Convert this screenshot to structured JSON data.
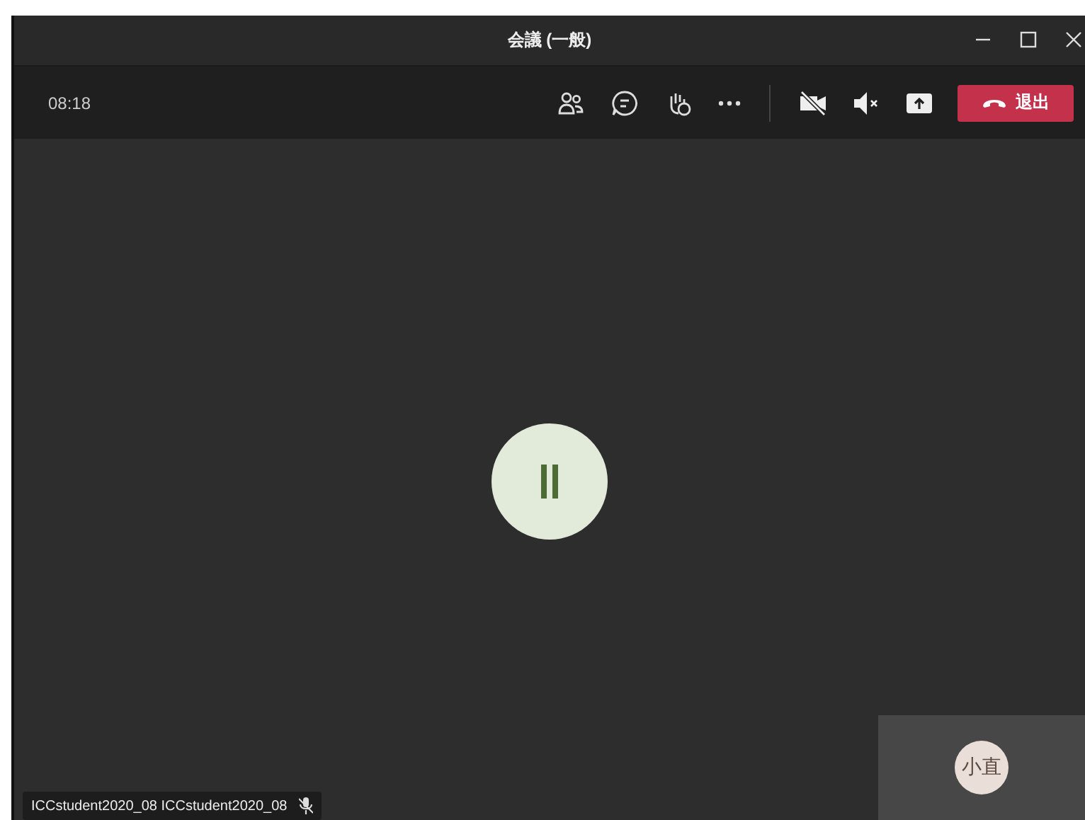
{
  "window": {
    "title": "会議 (一般)"
  },
  "toolbar": {
    "timer": "08:18",
    "leave_button": "退出"
  },
  "participants": [
    {
      "name": "ICCstudent2020_08 ICCstudent2020_08",
      "muted": true
    }
  ],
  "self_view": {
    "initials": "小直"
  }
}
